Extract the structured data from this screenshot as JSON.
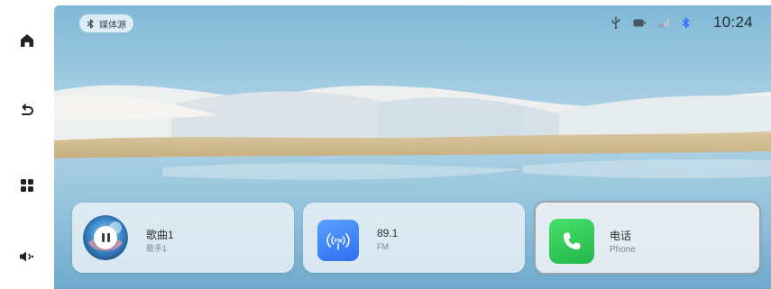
{
  "status_bar": {
    "source_label": "媒体源",
    "time": "10:24",
    "icons": [
      "usb-icon",
      "battery-icon",
      "signal-icon",
      "bluetooth-icon"
    ]
  },
  "rail": {
    "items": [
      "home-icon",
      "back-icon",
      "apps-icon",
      "volume-icon"
    ]
  },
  "cards": {
    "music": {
      "title": "歌曲1",
      "subtitle": "歌手1",
      "state": "playing"
    },
    "radio": {
      "title": "89.1",
      "subtitle": "FM",
      "icon_text": "FM"
    },
    "phone": {
      "title": "电话",
      "subtitle": "Phone"
    }
  },
  "colors": {
    "fm_blue": "#2f6df0",
    "phone_green": "#21b84a",
    "bluetooth_blue": "#2e6bff"
  }
}
